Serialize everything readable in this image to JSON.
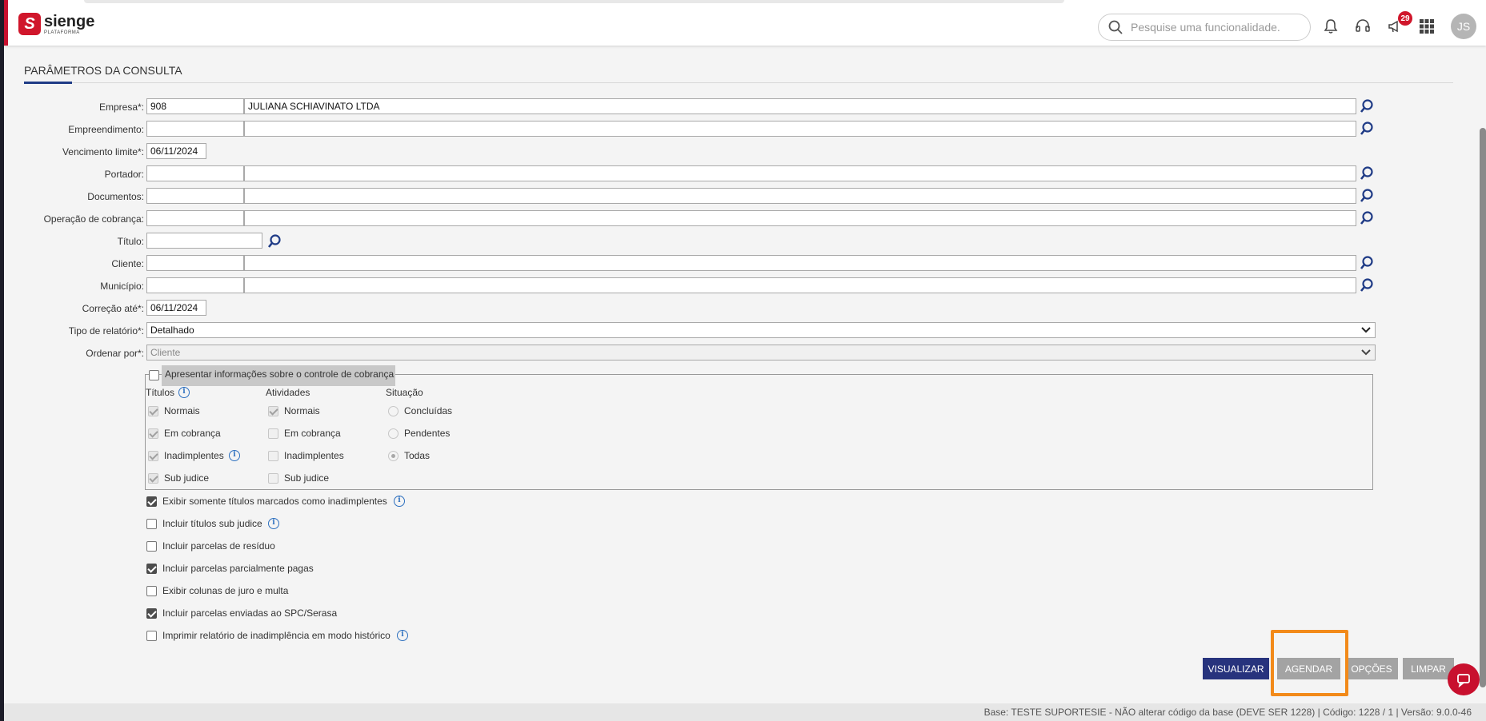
{
  "header": {
    "brand_name": "sienge",
    "brand_sub": "PLATAFORMA",
    "search_placeholder": "Pesquise uma funcionalidade.",
    "notification_count": "29",
    "user_initials": "JS"
  },
  "section": {
    "title": "PARÂMETROS DA CONSULTA"
  },
  "form": {
    "empresa": {
      "label": "Empresa*:",
      "code": "908",
      "name": "JULIANA SCHIAVINATO LTDA"
    },
    "empreendimento": {
      "label": "Empreendimento:",
      "code": "",
      "name": ""
    },
    "vencimento": {
      "label": "Vencimento limite*:",
      "value": "06/11/2024"
    },
    "portador": {
      "label": "Portador:",
      "code": "",
      "name": ""
    },
    "documentos": {
      "label": "Documentos:",
      "code": "",
      "name": ""
    },
    "operacao": {
      "label": "Operação de cobrança:",
      "code": "",
      "name": ""
    },
    "titulo": {
      "label": "Título:",
      "value": ""
    },
    "cliente": {
      "label": "Cliente:",
      "code": "",
      "name": ""
    },
    "municipio": {
      "label": "Município:",
      "code": "",
      "name": ""
    },
    "correcao": {
      "label": "Correção até*:",
      "value": "06/11/2024"
    },
    "tipo_relatorio": {
      "label": "Tipo de relatório*:",
      "value": "Detalhado"
    },
    "ordenar": {
      "label": "Ordenar por*:",
      "value": "Cliente"
    }
  },
  "controle": {
    "label": "Apresentar informações sobre o controle de cobrança",
    "titulos": {
      "header": "Títulos",
      "items": [
        "Normais",
        "Em cobrança",
        "Inadimplentes",
        "Sub judice"
      ]
    },
    "atividades": {
      "header": "Atividades",
      "items": [
        "Normais",
        "Em cobrança",
        "Inadimplentes",
        "Sub judice"
      ]
    },
    "situacao": {
      "header": "Situação",
      "items": [
        "Concluídas",
        "Pendentes",
        "Todas"
      ],
      "selected": "Todas"
    }
  },
  "options": [
    {
      "label": "Exibir somente títulos marcados como inadimplentes",
      "checked": true
    },
    {
      "label": "Incluir títulos sub judice",
      "checked": false
    },
    {
      "label": "Incluir parcelas de resíduo",
      "checked": false
    },
    {
      "label": "Incluir parcelas parcialmente pagas",
      "checked": true
    },
    {
      "label": "Exibir colunas de juro e multa",
      "checked": false
    },
    {
      "label": "Incluir parcelas enviadas ao SPC/Serasa",
      "checked": true
    },
    {
      "label": "Imprimir relatório de inadimplência em modo histórico",
      "checked": false
    }
  ],
  "buttons": {
    "visualizar": "VISUALIZAR",
    "agendar": "AGENDAR",
    "opcoes": "OPÇÕES",
    "limpar": "LIMPAR"
  },
  "footer": {
    "text": "Base: TESTE SUPORTESIE - NÃO alterar código da base (DEVE SER 1228) | Código: 1228 / 1 | Versão: 9.0.0-46"
  },
  "colors": {
    "brand": "#d0162b",
    "primary_button": "#27337d",
    "highlight": "#f28a1a"
  }
}
